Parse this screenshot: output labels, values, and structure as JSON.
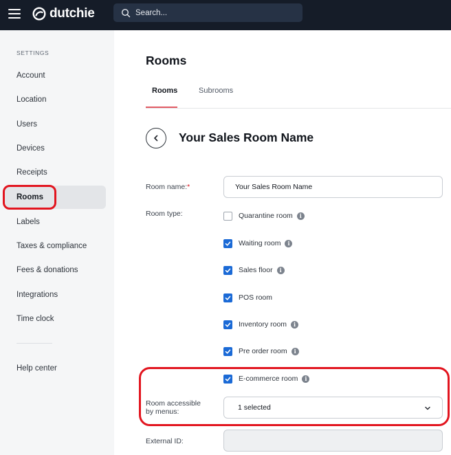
{
  "topbar": {
    "logo_text": "dutchie",
    "search_placeholder": "Search..."
  },
  "sidebar": {
    "heading": "SETTINGS",
    "items": [
      {
        "label": "Account"
      },
      {
        "label": "Location"
      },
      {
        "label": "Users"
      },
      {
        "label": "Devices"
      },
      {
        "label": "Receipts"
      },
      {
        "label": "Rooms",
        "active": true
      },
      {
        "label": "Labels"
      },
      {
        "label": "Taxes & compliance"
      },
      {
        "label": "Fees & donations"
      },
      {
        "label": "Integrations"
      },
      {
        "label": "Time clock"
      }
    ],
    "help": "Help center"
  },
  "main": {
    "title": "Rooms",
    "tabs": [
      {
        "label": "Rooms",
        "active": true
      },
      {
        "label": "Subrooms"
      }
    ],
    "room_title": "Your Sales Room Name",
    "form": {
      "room_name_label": "Room name:",
      "required_mark": "*",
      "room_name_value": "Your Sales Room Name",
      "room_type_label": "Room type:",
      "room_types": [
        {
          "label": "Quarantine room",
          "checked": false,
          "info": true
        },
        {
          "label": "Waiting room",
          "checked": true,
          "info": true
        },
        {
          "label": "Sales floor",
          "checked": true,
          "info": true
        },
        {
          "label": "POS room",
          "checked": true,
          "info": false
        },
        {
          "label": "Inventory room",
          "checked": true,
          "info": true
        },
        {
          "label": "Pre order room",
          "checked": true,
          "info": true
        },
        {
          "label": "E-commerce room",
          "checked": true,
          "info": true
        }
      ],
      "menus_label_line1": "Room accessible",
      "menus_label_line2": "by menus:",
      "menus_value": "1 selected",
      "external_id_label": "External ID:",
      "external_id_value": ""
    }
  },
  "colors": {
    "topbar": "#151c28",
    "accent_blue": "#1b6ad6",
    "highlight_red": "#e2141e",
    "tab_underline": "#e25a63"
  }
}
